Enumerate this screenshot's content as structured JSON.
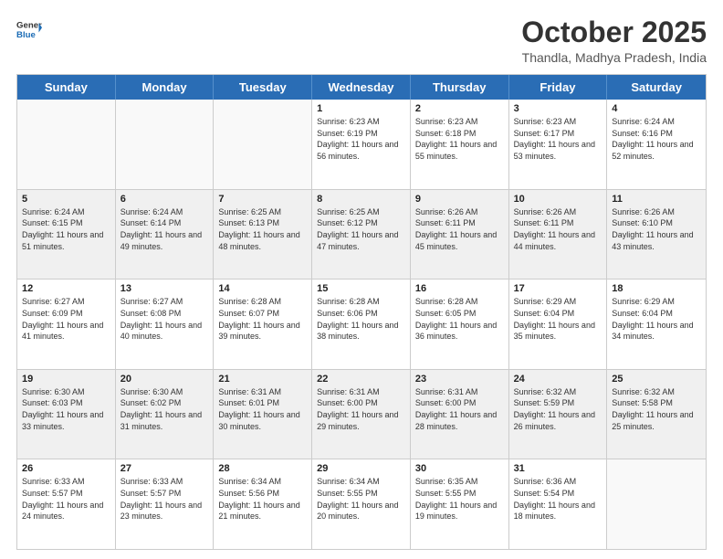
{
  "header": {
    "logo_general": "General",
    "logo_blue": "Blue",
    "title": "October 2025",
    "location": "Thandla, Madhya Pradesh, India"
  },
  "days_of_week": [
    "Sunday",
    "Monday",
    "Tuesday",
    "Wednesday",
    "Thursday",
    "Friday",
    "Saturday"
  ],
  "weeks": [
    [
      {
        "day": "",
        "sunrise": "",
        "sunset": "",
        "daylight": "",
        "empty": true
      },
      {
        "day": "",
        "sunrise": "",
        "sunset": "",
        "daylight": "",
        "empty": true
      },
      {
        "day": "",
        "sunrise": "",
        "sunset": "",
        "daylight": "",
        "empty": true
      },
      {
        "day": "1",
        "sunrise": "Sunrise: 6:23 AM",
        "sunset": "Sunset: 6:19 PM",
        "daylight": "Daylight: 11 hours and 56 minutes."
      },
      {
        "day": "2",
        "sunrise": "Sunrise: 6:23 AM",
        "sunset": "Sunset: 6:18 PM",
        "daylight": "Daylight: 11 hours and 55 minutes."
      },
      {
        "day": "3",
        "sunrise": "Sunrise: 6:23 AM",
        "sunset": "Sunset: 6:17 PM",
        "daylight": "Daylight: 11 hours and 53 minutes."
      },
      {
        "day": "4",
        "sunrise": "Sunrise: 6:24 AM",
        "sunset": "Sunset: 6:16 PM",
        "daylight": "Daylight: 11 hours and 52 minutes."
      }
    ],
    [
      {
        "day": "5",
        "sunrise": "Sunrise: 6:24 AM",
        "sunset": "Sunset: 6:15 PM",
        "daylight": "Daylight: 11 hours and 51 minutes."
      },
      {
        "day": "6",
        "sunrise": "Sunrise: 6:24 AM",
        "sunset": "Sunset: 6:14 PM",
        "daylight": "Daylight: 11 hours and 49 minutes."
      },
      {
        "day": "7",
        "sunrise": "Sunrise: 6:25 AM",
        "sunset": "Sunset: 6:13 PM",
        "daylight": "Daylight: 11 hours and 48 minutes."
      },
      {
        "day": "8",
        "sunrise": "Sunrise: 6:25 AM",
        "sunset": "Sunset: 6:12 PM",
        "daylight": "Daylight: 11 hours and 47 minutes."
      },
      {
        "day": "9",
        "sunrise": "Sunrise: 6:26 AM",
        "sunset": "Sunset: 6:11 PM",
        "daylight": "Daylight: 11 hours and 45 minutes."
      },
      {
        "day": "10",
        "sunrise": "Sunrise: 6:26 AM",
        "sunset": "Sunset: 6:11 PM",
        "daylight": "Daylight: 11 hours and 44 minutes."
      },
      {
        "day": "11",
        "sunrise": "Sunrise: 6:26 AM",
        "sunset": "Sunset: 6:10 PM",
        "daylight": "Daylight: 11 hours and 43 minutes."
      }
    ],
    [
      {
        "day": "12",
        "sunrise": "Sunrise: 6:27 AM",
        "sunset": "Sunset: 6:09 PM",
        "daylight": "Daylight: 11 hours and 41 minutes."
      },
      {
        "day": "13",
        "sunrise": "Sunrise: 6:27 AM",
        "sunset": "Sunset: 6:08 PM",
        "daylight": "Daylight: 11 hours and 40 minutes."
      },
      {
        "day": "14",
        "sunrise": "Sunrise: 6:28 AM",
        "sunset": "Sunset: 6:07 PM",
        "daylight": "Daylight: 11 hours and 39 minutes."
      },
      {
        "day": "15",
        "sunrise": "Sunrise: 6:28 AM",
        "sunset": "Sunset: 6:06 PM",
        "daylight": "Daylight: 11 hours and 38 minutes."
      },
      {
        "day": "16",
        "sunrise": "Sunrise: 6:28 AM",
        "sunset": "Sunset: 6:05 PM",
        "daylight": "Daylight: 11 hours and 36 minutes."
      },
      {
        "day": "17",
        "sunrise": "Sunrise: 6:29 AM",
        "sunset": "Sunset: 6:04 PM",
        "daylight": "Daylight: 11 hours and 35 minutes."
      },
      {
        "day": "18",
        "sunrise": "Sunrise: 6:29 AM",
        "sunset": "Sunset: 6:04 PM",
        "daylight": "Daylight: 11 hours and 34 minutes."
      }
    ],
    [
      {
        "day": "19",
        "sunrise": "Sunrise: 6:30 AM",
        "sunset": "Sunset: 6:03 PM",
        "daylight": "Daylight: 11 hours and 33 minutes."
      },
      {
        "day": "20",
        "sunrise": "Sunrise: 6:30 AM",
        "sunset": "Sunset: 6:02 PM",
        "daylight": "Daylight: 11 hours and 31 minutes."
      },
      {
        "day": "21",
        "sunrise": "Sunrise: 6:31 AM",
        "sunset": "Sunset: 6:01 PM",
        "daylight": "Daylight: 11 hours and 30 minutes."
      },
      {
        "day": "22",
        "sunrise": "Sunrise: 6:31 AM",
        "sunset": "Sunset: 6:00 PM",
        "daylight": "Daylight: 11 hours and 29 minutes."
      },
      {
        "day": "23",
        "sunrise": "Sunrise: 6:31 AM",
        "sunset": "Sunset: 6:00 PM",
        "daylight": "Daylight: 11 hours and 28 minutes."
      },
      {
        "day": "24",
        "sunrise": "Sunrise: 6:32 AM",
        "sunset": "Sunset: 5:59 PM",
        "daylight": "Daylight: 11 hours and 26 minutes."
      },
      {
        "day": "25",
        "sunrise": "Sunrise: 6:32 AM",
        "sunset": "Sunset: 5:58 PM",
        "daylight": "Daylight: 11 hours and 25 minutes."
      }
    ],
    [
      {
        "day": "26",
        "sunrise": "Sunrise: 6:33 AM",
        "sunset": "Sunset: 5:57 PM",
        "daylight": "Daylight: 11 hours and 24 minutes."
      },
      {
        "day": "27",
        "sunrise": "Sunrise: 6:33 AM",
        "sunset": "Sunset: 5:57 PM",
        "daylight": "Daylight: 11 hours and 23 minutes."
      },
      {
        "day": "28",
        "sunrise": "Sunrise: 6:34 AM",
        "sunset": "Sunset: 5:56 PM",
        "daylight": "Daylight: 11 hours and 21 minutes."
      },
      {
        "day": "29",
        "sunrise": "Sunrise: 6:34 AM",
        "sunset": "Sunset: 5:55 PM",
        "daylight": "Daylight: 11 hours and 20 minutes."
      },
      {
        "day": "30",
        "sunrise": "Sunrise: 6:35 AM",
        "sunset": "Sunset: 5:55 PM",
        "daylight": "Daylight: 11 hours and 19 minutes."
      },
      {
        "day": "31",
        "sunrise": "Sunrise: 6:36 AM",
        "sunset": "Sunset: 5:54 PM",
        "daylight": "Daylight: 11 hours and 18 minutes."
      },
      {
        "day": "",
        "sunrise": "",
        "sunset": "",
        "daylight": "",
        "empty": true
      }
    ]
  ]
}
